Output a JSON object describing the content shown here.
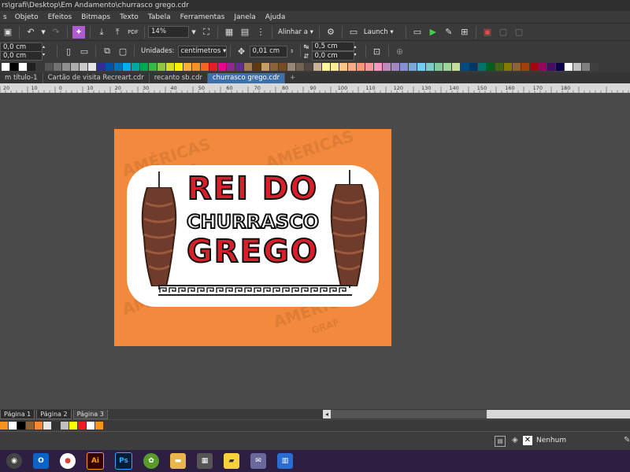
{
  "window": {
    "title": "rs\\grafi\\Desktop\\Em Andamento\\churrasco grego.cdr"
  },
  "menu": [
    "Objeto",
    "Efeitos",
    "Bitmaps",
    "Texto",
    "Tabela",
    "Ferramentas",
    "Janela",
    "Ajuda"
  ],
  "toolbar": {
    "zoom_value": "14%",
    "align_label": "Alinhar a",
    "launch_label": "Launch"
  },
  "property_bar": {
    "width_value": "0,0 cm",
    "height_value": "0,0 cm",
    "units_label": "Unidades:",
    "units_value": "centímetros",
    "nudge_value": "0,01 cm",
    "dup_x_value": "0,5 cm",
    "dup_y_value": "0,0 cm"
  },
  "palette_colors": [
    "#ffffff",
    "#000000",
    "#ffffff",
    "#1f1f1f",
    "#383838",
    "#555555",
    "#727272",
    "#8f8f8f",
    "#adadad",
    "#cacaca",
    "#e6e6e6",
    "#2e3192",
    "#0054a6",
    "#0072bc",
    "#00aeef",
    "#00a99d",
    "#00a651",
    "#39b54a",
    "#8dc63f",
    "#d7df23",
    "#fff200",
    "#fbaf3b",
    "#f7941d",
    "#f26522",
    "#ed1c24",
    "#ec008c",
    "#92278f",
    "#662d91",
    "#a67c52",
    "#603913",
    "#c69c6d",
    "#8c6239",
    "#754c24",
    "#998675",
    "#736357",
    "#534741",
    "#c7b299",
    "#fff799",
    "#ffe9a0",
    "#fdc689",
    "#f9ad81",
    "#f69679",
    "#f5989d",
    "#f49ac1",
    "#bd8cbf",
    "#a187be",
    "#8393ca",
    "#7da7d9",
    "#6dcff6",
    "#7accc8",
    "#82ca9c",
    "#a3d39c",
    "#c4df9b",
    "#004a80",
    "#003663",
    "#00746b",
    "#005e20",
    "#406618",
    "#827b00",
    "#8c6239",
    "#a0410d",
    "#9e0b0f",
    "#9e005d",
    "#440e62",
    "#0d004c",
    "#ffffff",
    "#c0c0c0",
    "#808080",
    "#404040"
  ],
  "tabs": [
    "m título-1",
    "Cartão de visita Recreart.cdr",
    "recanto sb.cdr",
    "churrasco grego.cdr"
  ],
  "ruler_labels": [
    "20",
    "10",
    "0",
    "10",
    "20",
    "30",
    "40",
    "50",
    "60",
    "70",
    "80",
    "90",
    "100",
    "110",
    "120",
    "130",
    "140",
    "150",
    "160",
    "170",
    "180"
  ],
  "artwork": {
    "line1": "REI DO",
    "line2": "CHURRASCO",
    "line3": "GREGO",
    "watermark": "AMÉRICAS",
    "watermark_sub": "GRAF"
  },
  "pages": [
    "Página 1",
    "Página 2",
    "Página 3"
  ],
  "doc_palette_colors": [
    "#f7941d",
    "#ffffff",
    "#000000",
    "#8c6239",
    "#f3893c",
    "#e6e6e6",
    "#333333",
    "#c0c0c0",
    "#ffff00",
    "#ed1c24",
    "#ffffff",
    "#f7941d"
  ],
  "status": {
    "fill_label": "Nenhum"
  },
  "taskbar_apps": [
    "Outlook",
    "Chrome",
    "Illustrator",
    "Photoshop",
    "CorelDRAW",
    "File Explorer",
    "Calculator",
    "Sticky Notes",
    "Mail",
    "Calendar"
  ]
}
